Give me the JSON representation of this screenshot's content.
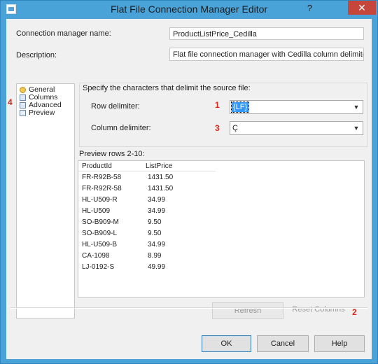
{
  "window": {
    "title": "Flat File Connection Manager Editor",
    "help_glyph": "?",
    "close_glyph": "✕"
  },
  "form": {
    "name_label": "Connection manager name:",
    "name_value": "ProductListPrice_Cedilla",
    "description_label": "Description:",
    "description_value": "Flat file connection manager with Cedilla column delimiter."
  },
  "nav": {
    "items": [
      {
        "label": "General"
      },
      {
        "label": "Columns"
      },
      {
        "label": "Advanced"
      },
      {
        "label": "Preview"
      }
    ]
  },
  "delimiters": {
    "instruction": "Specify the characters that delimit the source file:",
    "row_label": "Row delimiter:",
    "row_value": "{LF}",
    "column_label": "Column delimiter:",
    "column_value": "Ç"
  },
  "preview": {
    "label": "Preview rows 2-10:",
    "columns": [
      "ProductId",
      "ListPrice"
    ],
    "rows": [
      [
        "FR-R92B-58",
        "1431.50"
      ],
      [
        "FR-R92R-58",
        "1431.50"
      ],
      [
        "HL-U509-R",
        "34.99"
      ],
      [
        "HL-U509",
        "34.99"
      ],
      [
        "SO-B909-M",
        "9.50"
      ],
      [
        "SO-B909-L",
        "9.50"
      ],
      [
        "HL-U509-B",
        "34.99"
      ],
      [
        "CA-1098",
        "8.99"
      ],
      [
        "LJ-0192-S",
        "49.99"
      ]
    ]
  },
  "buttons": {
    "refresh": "Refresh",
    "reset_columns": "Reset Columns",
    "ok": "OK",
    "cancel": "Cancel",
    "help": "Help"
  },
  "annotations": {
    "a1": "1",
    "a2": "2",
    "a3": "3",
    "a4": "4"
  },
  "colors": {
    "title_bar": "#4aa3d8",
    "close_button": "#c7463b",
    "annotation": "#d9271c",
    "selection": "#3399ff"
  }
}
